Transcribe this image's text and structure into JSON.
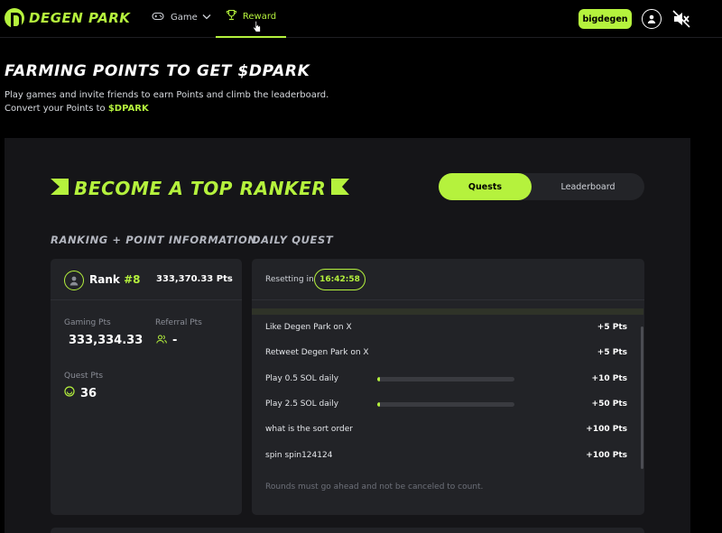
{
  "brand": {
    "name": "DEGEN PARK",
    "accent_color": "#b5f23d"
  },
  "nav": {
    "game_label": "Game",
    "reward_label": "Reward",
    "game_icon": "gamepad-icon",
    "reward_icon": "trophy-icon"
  },
  "header": {
    "username": "bigdegen",
    "avatar_icon": "user-icon",
    "sound_icon": "volume-mute-icon"
  },
  "hero": {
    "title": "FARMING POINTS TO GET $DPARK",
    "subtitle_line1": "Play games and invite friends to earn Points and climb the leaderboard.",
    "subtitle_line2_prefix": "Convert your Points to ",
    "subtitle_token": "$DPARK"
  },
  "section": {
    "title": "BECOME A TOP RANKER",
    "tabs": {
      "quests": "Quests",
      "leaderboard": "Leaderboard",
      "active": "Quests"
    },
    "ranking_label": "RANKING + POINT INFORMATION",
    "daily_label": "DAILY QUEST"
  },
  "ranking": {
    "rank_label": "Rank",
    "rank_number": "#8",
    "total_pts": "333,370.33 Pts",
    "gaming_label": "Gaming Pts",
    "gaming_value": "333,334.33",
    "referral_label": "Referral Pts",
    "referral_value": "-",
    "quest_label": "Quest Pts",
    "quest_value": "36"
  },
  "daily": {
    "resetting_label": "Resetting in",
    "timer": "16:42:58",
    "quests": [
      {
        "name": "Like Degen Park on X",
        "points": "+5 Pts"
      },
      {
        "name": "Retweet Degen Park on X",
        "points": "+5 Pts"
      },
      {
        "name": "Play 0.5 SOL daily",
        "points": "+10 Pts",
        "progress": 0.02
      },
      {
        "name": "Play 2.5 SOL daily",
        "points": "+50 Pts",
        "progress": 0.01
      },
      {
        "name": "what is the sort order",
        "points": "+100 Pts"
      },
      {
        "name": "spin spin124124",
        "points": "+100 Pts"
      }
    ],
    "note": "Rounds must go ahead and not be canceled to count."
  }
}
